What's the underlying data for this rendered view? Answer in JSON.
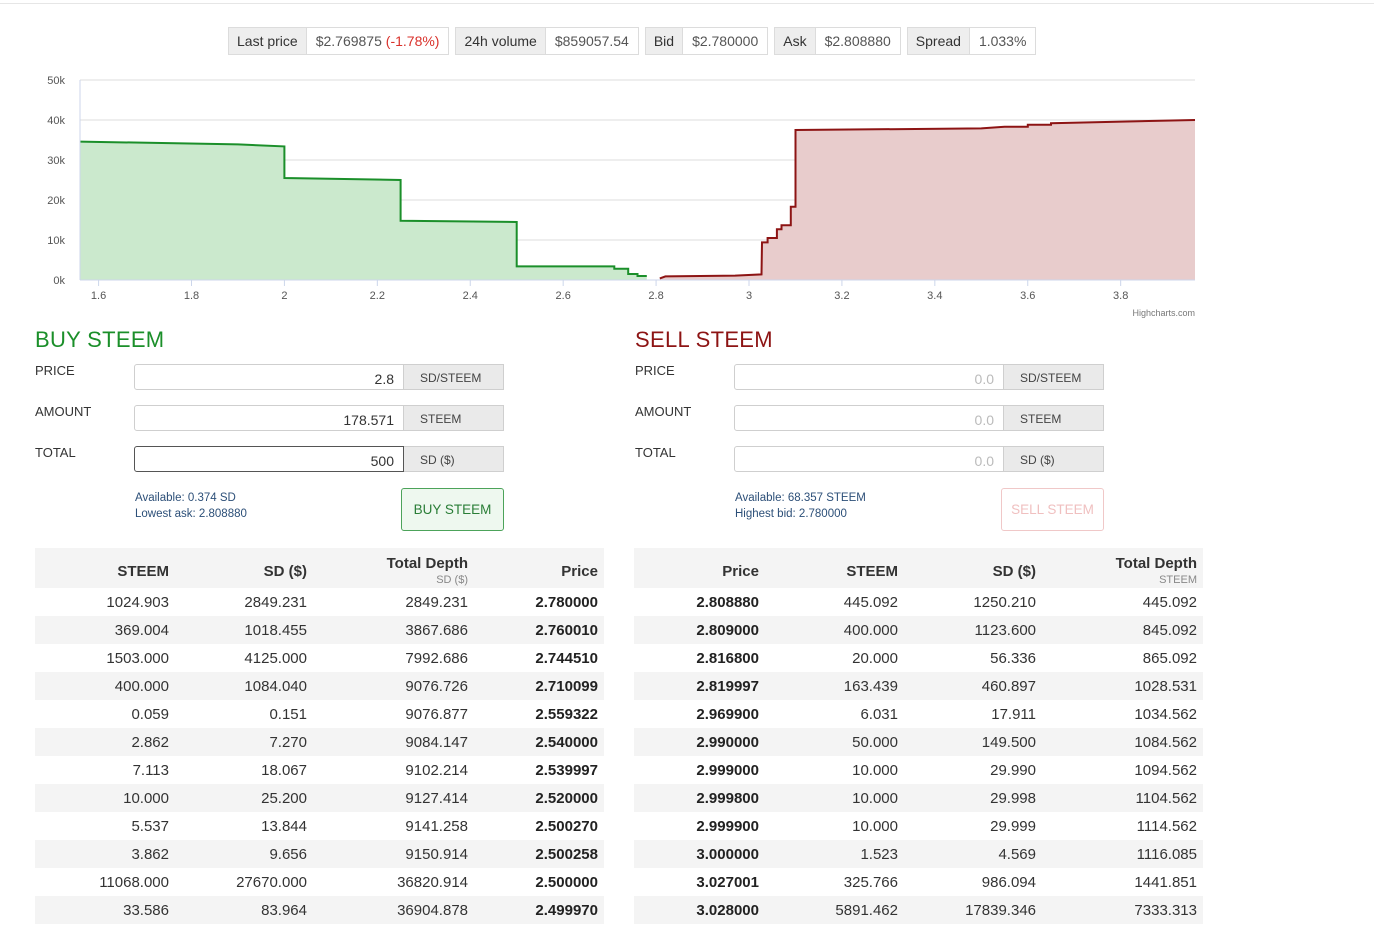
{
  "ticker": [
    {
      "label": "Last price",
      "value": "$2.769875",
      "change": "(-1.78%)"
    },
    {
      "label": "24h volume",
      "value": "$859057.54"
    },
    {
      "label": "Bid",
      "value": "$2.780000"
    },
    {
      "label": "Ask",
      "value": "$2.808880"
    },
    {
      "label": "Spread",
      "value": "1.033%"
    }
  ],
  "chart_data": {
    "type": "area",
    "xlim": [
      1.56,
      3.96
    ],
    "ylim": [
      0,
      50000
    ],
    "x_ticks": [
      "1.6",
      "1.8",
      "2",
      "2.2",
      "2.4",
      "2.6",
      "2.8",
      "3",
      "3.2",
      "3.4",
      "3.6",
      "3.8"
    ],
    "y_ticks": [
      "0k",
      "10k",
      "20k",
      "30k",
      "40k",
      "50k"
    ],
    "credit": "Highcharts.com",
    "grid": true,
    "series": [
      {
        "color": "#1b8f2a",
        "fill": "#cbe9cd",
        "points": [
          [
            1.56,
            34600
          ],
          [
            1.9,
            33900
          ],
          [
            2.0,
            33400
          ],
          [
            2.0,
            25500
          ],
          [
            2.25,
            25000
          ],
          [
            2.25,
            14800
          ],
          [
            2.5,
            14500
          ],
          [
            2.5,
            3400
          ],
          [
            2.71,
            3400
          ],
          [
            2.71,
            2800
          ],
          [
            2.74,
            2800
          ],
          [
            2.74,
            1500
          ],
          [
            2.76,
            1500
          ],
          [
            2.76,
            1000
          ],
          [
            2.78,
            1000
          ]
        ]
      },
      {
        "color": "#8d1414",
        "fill": "#e8cccc",
        "points": [
          [
            2.808,
            400
          ],
          [
            2.82,
            900
          ],
          [
            2.97,
            1100
          ],
          [
            3.027,
            1400
          ],
          [
            3.028,
            9400
          ],
          [
            3.04,
            9400
          ],
          [
            3.04,
            10500
          ],
          [
            3.06,
            10500
          ],
          [
            3.06,
            12700
          ],
          [
            3.07,
            12700
          ],
          [
            3.07,
            13700
          ],
          [
            3.09,
            13700
          ],
          [
            3.09,
            18300
          ],
          [
            3.1,
            18300
          ],
          [
            3.1,
            37500
          ],
          [
            3.5,
            37900
          ],
          [
            3.55,
            38300
          ],
          [
            3.6,
            38300
          ],
          [
            3.6,
            38800
          ],
          [
            3.65,
            38800
          ],
          [
            3.65,
            39200
          ],
          [
            3.96,
            40000
          ]
        ]
      }
    ]
  },
  "buy": {
    "title": "BUY STEEM",
    "price_label": "PRICE",
    "price_value": "2.8",
    "price_unit": "SD/STEEM",
    "amount_label": "AMOUNT",
    "amount_value": "178.571",
    "amount_unit": "STEEM",
    "total_label": "TOTAL",
    "total_value": "500",
    "total_unit": "SD ($)",
    "available": "Available: 0.374 SD",
    "lowest": "Lowest ask: 2.808880",
    "button": "BUY STEEM"
  },
  "sell": {
    "title": "SELL STEEM",
    "price_label": "PRICE",
    "price_value": "0.0",
    "price_unit": "SD/STEEM",
    "amount_label": "AMOUNT",
    "amount_value": "0.0",
    "amount_unit": "STEEM",
    "total_label": "TOTAL",
    "total_value": "0.0",
    "total_unit": "SD ($)",
    "available": "Available: 68.357 STEEM",
    "highest": "Highest bid: 2.780000",
    "button": "SELL STEEM"
  },
  "bids": {
    "headers": [
      "STEEM",
      "SD ($)",
      "Total Depth",
      "Price"
    ],
    "depth_sub": "SD ($)",
    "rows": [
      [
        "1024.903",
        "2849.231",
        "2849.231",
        "2.780000"
      ],
      [
        "369.004",
        "1018.455",
        "3867.686",
        "2.760010"
      ],
      [
        "1503.000",
        "4125.000",
        "7992.686",
        "2.744510"
      ],
      [
        "400.000",
        "1084.040",
        "9076.726",
        "2.710099"
      ],
      [
        "0.059",
        "0.151",
        "9076.877",
        "2.559322"
      ],
      [
        "2.862",
        "7.270",
        "9084.147",
        "2.540000"
      ],
      [
        "7.113",
        "18.067",
        "9102.214",
        "2.539997"
      ],
      [
        "10.000",
        "25.200",
        "9127.414",
        "2.520000"
      ],
      [
        "5.537",
        "13.844",
        "9141.258",
        "2.500270"
      ],
      [
        "3.862",
        "9.656",
        "9150.914",
        "2.500258"
      ],
      [
        "11068.000",
        "27670.000",
        "36820.914",
        "2.500000"
      ],
      [
        "33.586",
        "83.964",
        "36904.878",
        "2.499970"
      ]
    ]
  },
  "asks": {
    "headers": [
      "Price",
      "STEEM",
      "SD ($)",
      "Total Depth"
    ],
    "depth_sub": "STEEM",
    "rows": [
      [
        "2.808880",
        "445.092",
        "1250.210",
        "445.092"
      ],
      [
        "2.809000",
        "400.000",
        "1123.600",
        "845.092"
      ],
      [
        "2.816800",
        "20.000",
        "56.336",
        "865.092"
      ],
      [
        "2.819997",
        "163.439",
        "460.897",
        "1028.531"
      ],
      [
        "2.969900",
        "6.031",
        "17.911",
        "1034.562"
      ],
      [
        "2.990000",
        "50.000",
        "149.500",
        "1084.562"
      ],
      [
        "2.999000",
        "10.000",
        "29.990",
        "1094.562"
      ],
      [
        "2.999800",
        "10.000",
        "29.998",
        "1104.562"
      ],
      [
        "2.999900",
        "10.000",
        "29.999",
        "1114.562"
      ],
      [
        "3.000000",
        "1.523",
        "4.569",
        "1116.085"
      ],
      [
        "3.027001",
        "325.766",
        "986.094",
        "1441.851"
      ],
      [
        "3.028000",
        "5891.462",
        "17839.346",
        "7333.313"
      ]
    ]
  }
}
